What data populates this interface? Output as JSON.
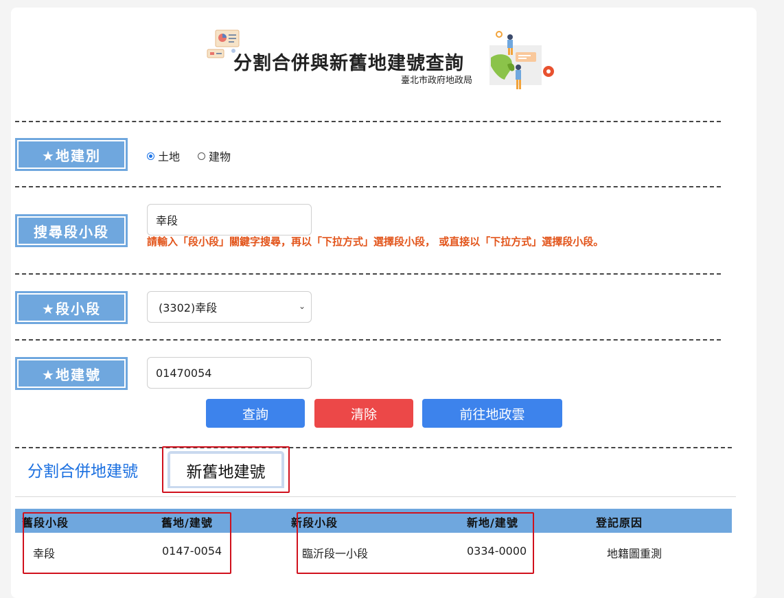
{
  "header": {
    "title": "分割合併與新舊地建號查詢",
    "subtitle": "臺北市政府地政局"
  },
  "form": {
    "type_label": "★地建別",
    "type_options": [
      {
        "label": "土地",
        "checked": true
      },
      {
        "label": "建物",
        "checked": false
      }
    ],
    "search_label": "搜尋段小段",
    "search_value": "幸段",
    "search_hint": "請輸入「段小段」關鍵字搜尋，再以「下拉方式」選擇段小段， 或直接以「下拉方式」選擇段小段。",
    "section_label": "★段小段",
    "section_selected": "(3302)幸段",
    "number_label": "★地建號",
    "number_value": "01470054"
  },
  "buttons": {
    "query": "查詢",
    "clear": "清除",
    "goto": "前往地政雲"
  },
  "tabs": {
    "split_merge": "分割合併地建號",
    "new_old": "新舊地建號"
  },
  "table": {
    "headers": [
      "舊段小段",
      "舊地/建號",
      "新段小段",
      "新地/建號",
      "登記原因"
    ],
    "rows": [
      [
        "幸段",
        "0147-0054",
        "臨沂段一小段",
        "0334-0000",
        "地籍圖重測"
      ]
    ]
  },
  "colors": {
    "label_bg": "#6fa7de",
    "button_blue": "#3d83ec",
    "button_red": "#ec4848",
    "hint_text": "#e2541a",
    "highlight_border": "#d0101c"
  }
}
